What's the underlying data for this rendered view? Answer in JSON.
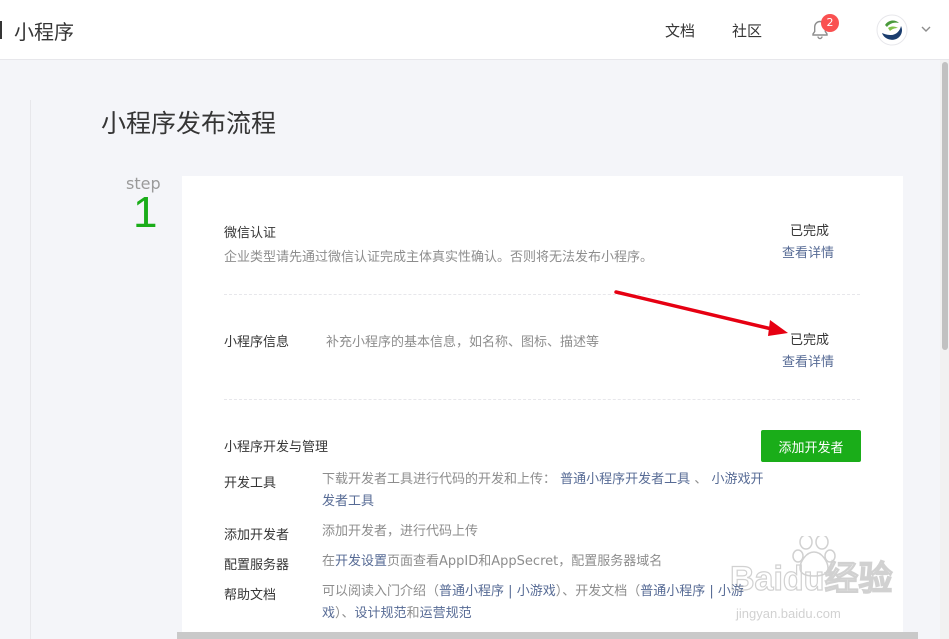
{
  "header": {
    "app_title": "小程序",
    "nav": [
      {
        "label": "文档"
      },
      {
        "label": "社区"
      }
    ],
    "notification_count": "2"
  },
  "page": {
    "title": "小程序发布流程",
    "step_label": "step",
    "step_number": "1"
  },
  "sections": {
    "wechat_verify": {
      "title": "微信认证",
      "desc": "企业类型请先通过微信认证完成主体真实性确认。否则将无法发布小程序。",
      "status": "已完成",
      "detail_link": "查看详情"
    },
    "mp_info": {
      "title": "小程序信息",
      "desc": "补充小程序的基本信息，如名称、图标、描述等",
      "status": "已完成",
      "detail_link": "查看详情"
    },
    "dev_manage": {
      "title": "小程序开发与管理",
      "add_dev_button": "添加开发者",
      "rows": {
        "tools": {
          "label": "开发工具",
          "text1": "下载开发者工具进行代码的开发和上传：",
          "link1": "普通小程序开发者工具",
          "sep": "、",
          "link2": "小游戏开发者工具"
        },
        "add_dev": {
          "label": "添加开发者",
          "text": "添加开发者，进行代码上传"
        },
        "server": {
          "label": "配置服务器",
          "text_before": "在",
          "link": "开发设置",
          "text_after": "页面查看AppID和AppSecret，配置服务器域名"
        },
        "help": {
          "label": "帮助文档",
          "t1": "可以阅读入门介绍（",
          "l1": "普通小程序",
          "s1": " | ",
          "l2": "小游戏",
          "t2": "）、开发文档（",
          "l3": "普通小程序",
          "s2": " | ",
          "l4": "小游戏",
          "t3": "）、",
          "l5": "设计规范",
          "t4": "和",
          "l6": "运营规范"
        }
      }
    }
  },
  "watermark": {
    "text": "Baidu经验",
    "sub": "jingyan.baidu.com"
  },
  "colors": {
    "accent_green": "#1aad19",
    "link_blue": "#576b95",
    "badge_red": "#fa5151",
    "arrow_red": "#e60012"
  }
}
